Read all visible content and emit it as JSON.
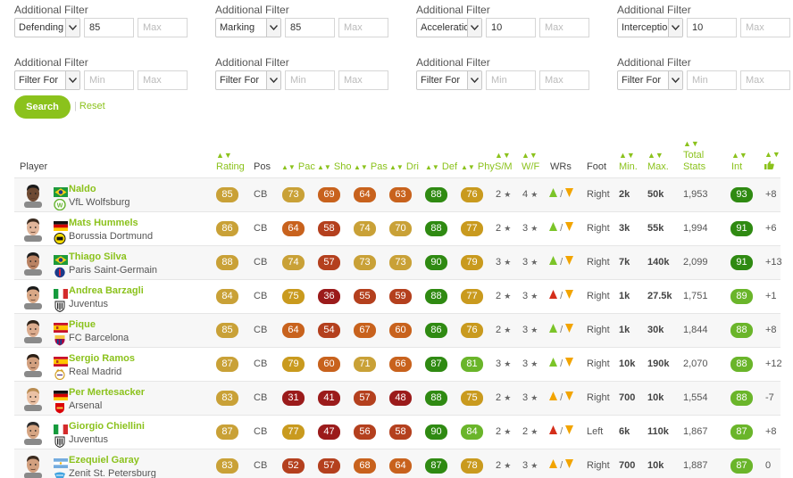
{
  "filters": [
    {
      "label": "Additional Filter",
      "select": "Defending",
      "min": "85",
      "max": "Max",
      "minPh": false
    },
    {
      "label": "Additional Filter",
      "select": "Marking",
      "min": "85",
      "max": "Max",
      "minPh": false
    },
    {
      "label": "Additional Filter",
      "select": "Acceleration",
      "min": "10",
      "max": "Max",
      "minPh": false
    },
    {
      "label": "Additional Filter",
      "select": "Interceptions",
      "min": "10",
      "max": "Max",
      "minPh": false
    },
    {
      "label": "Additional Filter",
      "select": "Filter For",
      "min": "Min",
      "max": "Max",
      "minPh": true
    },
    {
      "label": "Additional Filter",
      "select": "Filter For",
      "min": "Min",
      "max": "Max",
      "minPh": true
    },
    {
      "label": "Additional Filter",
      "select": "Filter For",
      "min": "Min",
      "max": "Max",
      "minPh": true
    },
    {
      "label": "Additional Filter",
      "select": "Filter For",
      "min": "Min",
      "max": "Max",
      "minPh": true
    }
  ],
  "buttons": {
    "search": "Search",
    "reset": "Reset",
    "reset_sep": "|"
  },
  "headers": {
    "player": "Player",
    "rating": "Rating",
    "pos": "Pos",
    "pac": "Pac",
    "sho": "Sho",
    "pas": "Pas",
    "dri": "Dri",
    "def": "Def",
    "phy": "Phy",
    "sm": "S/M",
    "wf": "W/F",
    "wrs": "WRs",
    "foot": "Foot",
    "min": "Min.",
    "max": "Max.",
    "total_stats_1": "Total",
    "total_stats_2": "Stats",
    "int": "Int"
  },
  "wr_sep": "/",
  "players": [
    {
      "name": "Naldo",
      "club": "VfL Wolfsburg",
      "flag": "brazil",
      "crest": "wolfsburg",
      "rating": "85",
      "pos": "CB",
      "pac": "73",
      "sho": "69",
      "pas": "64",
      "dri": "63",
      "def": "88",
      "phy": "76",
      "sm": "2",
      "wf": "4",
      "wr_att": "green",
      "wr_def": "orange",
      "foot": "Right",
      "min": "2k",
      "max": "50k",
      "total": "1,953",
      "int": "93",
      "trend": "+8"
    },
    {
      "name": "Mats Hummels",
      "club": "Borussia Dortmund",
      "flag": "germany",
      "crest": "dortmund",
      "rating": "86",
      "pos": "CB",
      "pac": "64",
      "sho": "58",
      "pas": "74",
      "dri": "70",
      "def": "88",
      "phy": "77",
      "sm": "2",
      "wf": "3",
      "wr_att": "green",
      "wr_def": "orange",
      "foot": "Right",
      "min": "3k",
      "max": "55k",
      "total": "1,994",
      "int": "91",
      "trend": "+6"
    },
    {
      "name": "Thiago Silva",
      "club": "Paris Saint-Germain",
      "flag": "brazil",
      "crest": "psg",
      "rating": "88",
      "pos": "CB",
      "pac": "74",
      "sho": "57",
      "pas": "73",
      "dri": "73",
      "def": "90",
      "phy": "79",
      "sm": "3",
      "wf": "3",
      "wr_att": "green",
      "wr_def": "orange",
      "foot": "Right",
      "min": "7k",
      "max": "140k",
      "total": "2,099",
      "int": "91",
      "trend": "+13"
    },
    {
      "name": "Andrea Barzagli",
      "club": "Juventus",
      "flag": "italy",
      "crest": "juventus",
      "rating": "84",
      "pos": "CB",
      "pac": "75",
      "sho": "36",
      "pas": "55",
      "dri": "59",
      "def": "88",
      "phy": "77",
      "sm": "2",
      "wf": "3",
      "wr_att": "red",
      "wr_def": "orange",
      "foot": "Right",
      "min": "1k",
      "max": "27.5k",
      "total": "1,751",
      "int": "89",
      "trend": "+1"
    },
    {
      "name": "Pique",
      "club": "FC Barcelona",
      "flag": "spain",
      "crest": "barcelona",
      "rating": "85",
      "pos": "CB",
      "pac": "64",
      "sho": "54",
      "pas": "67",
      "dri": "60",
      "def": "86",
      "phy": "76",
      "sm": "2",
      "wf": "3",
      "wr_att": "green",
      "wr_def": "orange",
      "foot": "Right",
      "min": "1k",
      "max": "30k",
      "total": "1,844",
      "int": "88",
      "trend": "+8"
    },
    {
      "name": "Sergio Ramos",
      "club": "Real Madrid",
      "flag": "spain",
      "crest": "realmadrid",
      "rating": "87",
      "pos": "CB",
      "pac": "79",
      "sho": "60",
      "pas": "71",
      "dri": "66",
      "def": "87",
      "phy": "81",
      "sm": "3",
      "wf": "3",
      "wr_att": "green",
      "wr_def": "orange",
      "foot": "Right",
      "min": "10k",
      "max": "190k",
      "total": "2,070",
      "int": "88",
      "trend": "+12"
    },
    {
      "name": "Per Mertesacker",
      "club": "Arsenal",
      "flag": "germany",
      "crest": "arsenal",
      "rating": "83",
      "pos": "CB",
      "pac": "31",
      "sho": "41",
      "pas": "57",
      "dri": "48",
      "def": "88",
      "phy": "75",
      "sm": "2",
      "wf": "3",
      "wr_att": "orange",
      "wr_def": "orange",
      "foot": "Right",
      "min": "700",
      "max": "10k",
      "total": "1,554",
      "int": "88",
      "trend": "-7"
    },
    {
      "name": "Giorgio Chiellini",
      "club": "Juventus",
      "flag": "italy",
      "crest": "juventus",
      "rating": "87",
      "pos": "CB",
      "pac": "77",
      "sho": "47",
      "pas": "56",
      "dri": "58",
      "def": "90",
      "phy": "84",
      "sm": "2",
      "wf": "2",
      "wr_att": "red",
      "wr_def": "orange",
      "foot": "Left",
      "min": "6k",
      "max": "110k",
      "total": "1,867",
      "int": "87",
      "trend": "+8"
    },
    {
      "name": "Ezequiel Garay",
      "club": "Zenit St. Petersburg",
      "flag": "argentina",
      "crest": "zenit",
      "rating": "83",
      "pos": "CB",
      "pac": "52",
      "sho": "57",
      "pas": "68",
      "dri": "64",
      "def": "87",
      "phy": "78",
      "sm": "2",
      "wf": "3",
      "wr_att": "orange",
      "wr_def": "orange",
      "foot": "Right",
      "min": "700",
      "max": "10k",
      "total": "1,887",
      "int": "87",
      "trend": "0"
    }
  ],
  "colors": {
    "accent": "#8bc21c",
    "gold": "#c9a137",
    "red": "#9b1b1b",
    "brown": "#b4401e",
    "orange": "#c8621d",
    "olive": "#c99a1e",
    "green": "#6ab52a",
    "darkgreen": "#2f8a12",
    "wr_green": "#7bc428",
    "wr_orange": "#f2a400",
    "wr_red": "#d42e1a"
  }
}
